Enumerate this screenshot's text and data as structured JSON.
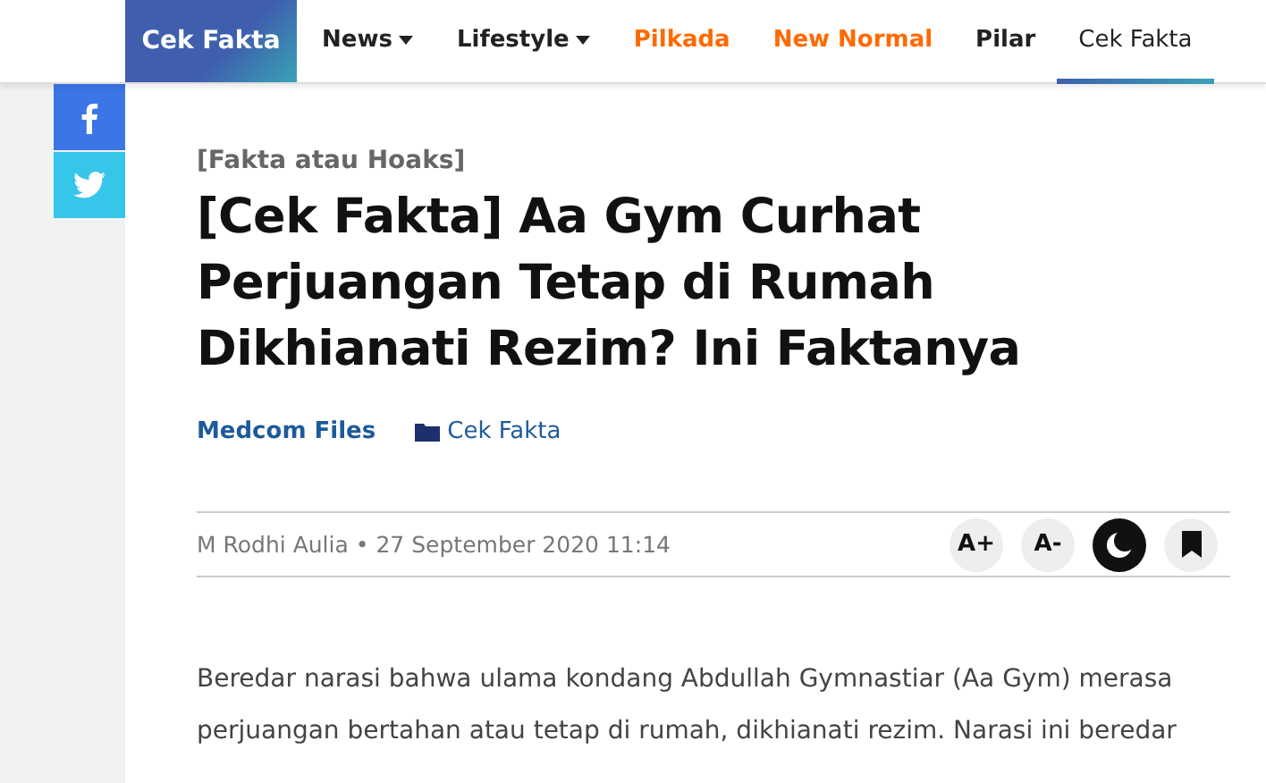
{
  "brand": {
    "label": "Cek Fakta"
  },
  "nav": [
    {
      "label": "News",
      "dropdown": true,
      "selected": false,
      "color": "#222222"
    },
    {
      "label": "Lifestyle",
      "dropdown": true,
      "selected": false,
      "color": "#222222"
    },
    {
      "label": "Pilkada",
      "dropdown": false,
      "selected": false,
      "color": "#ff6a00"
    },
    {
      "label": "New Normal",
      "dropdown": false,
      "selected": false,
      "color": "#ff6a00"
    },
    {
      "label": "Pilar",
      "dropdown": false,
      "selected": false,
      "color": "#222222"
    },
    {
      "label": "Cek Fakta",
      "dropdown": false,
      "selected": true,
      "color": "#222222"
    }
  ],
  "share": [
    {
      "kind": "facebook"
    },
    {
      "kind": "twitter"
    }
  ],
  "article": {
    "kicker": "[Fakta atau Hoaks]",
    "title": "[Cek Fakta] Aa Gym Curhat Perjuangan Tetap di Rumah Dikhianati Rezim? Ini Faktanya",
    "channel": "Medcom Files",
    "category": "Cek Fakta",
    "byline": "M Rodhi Aulia • 27 September 2020 11:14",
    "tools": [
      {
        "kind": "font-up",
        "label": "A+",
        "active": false
      },
      {
        "kind": "font-down",
        "label": "A-",
        "active": false
      },
      {
        "kind": "dark-mode",
        "active": true
      },
      {
        "kind": "bookmark",
        "active": false
      }
    ],
    "paragraph": "Beredar narasi bahwa ulama kondang Abdullah Gymnastiar (Aa Gym) merasa perjuangan bertahan atau tetap di rumah, dikhianati rezim. Narasi ini beredar"
  }
}
